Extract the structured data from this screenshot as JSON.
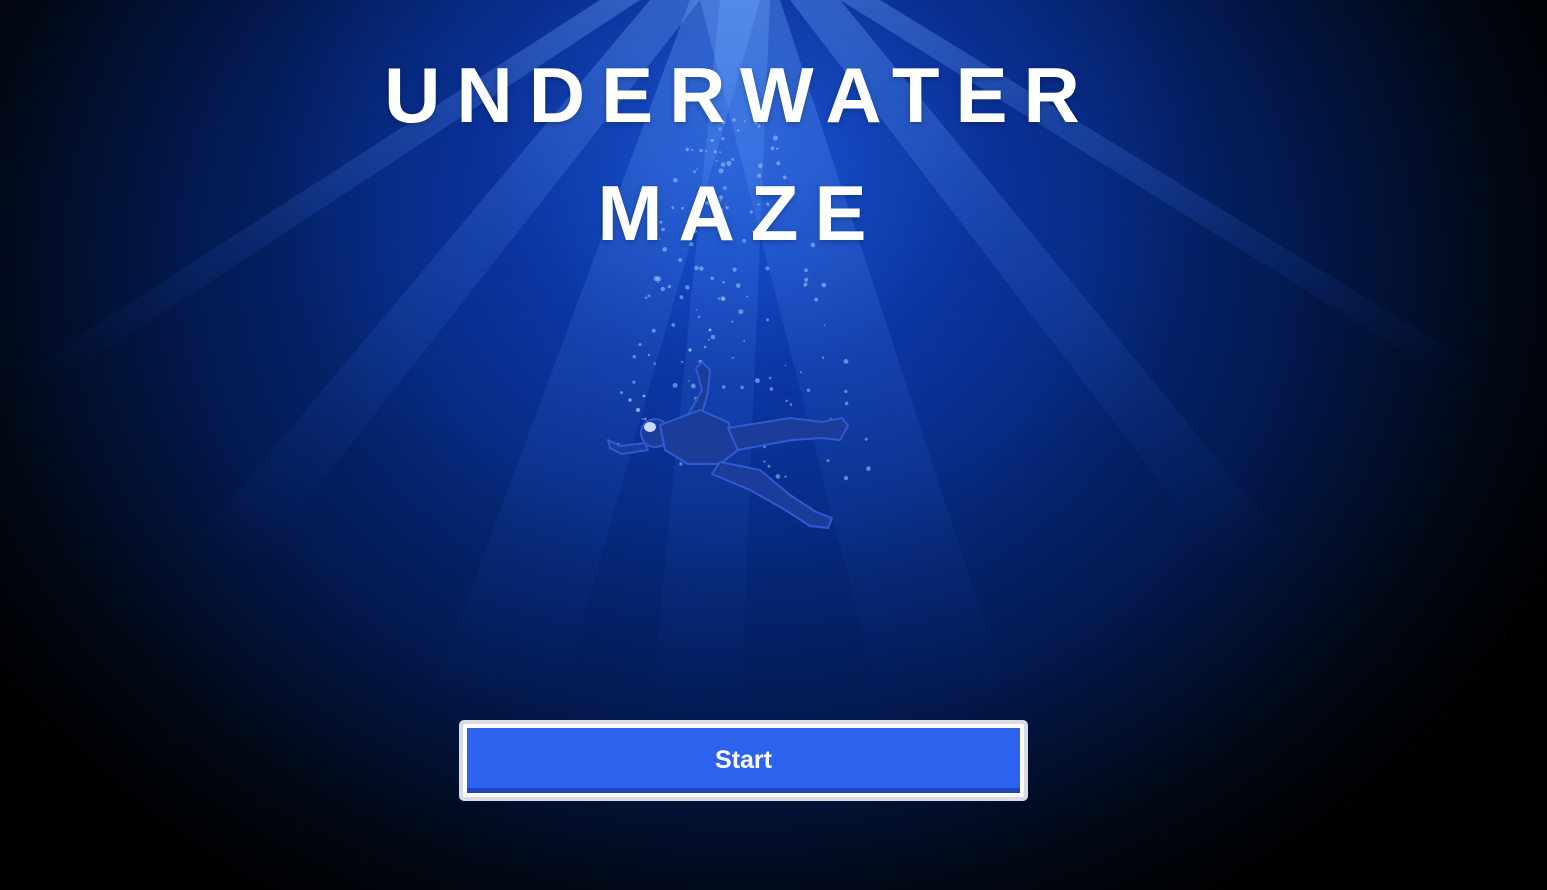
{
  "game": {
    "title_line1": "UNDERWATER",
    "title_line2": "MAZE",
    "start_label": "Start"
  },
  "colors": {
    "deep_water": "#000000",
    "mid_water": "#062a80",
    "light_water": "#2f7bff",
    "title_text": "#ffffff",
    "button_fill": "#2c63ee",
    "button_border": "#d9dce3",
    "diver": "#1c3c9a"
  },
  "icons": {
    "diver": "diver-silhouette",
    "bubbles": "bubbles-decoration"
  }
}
